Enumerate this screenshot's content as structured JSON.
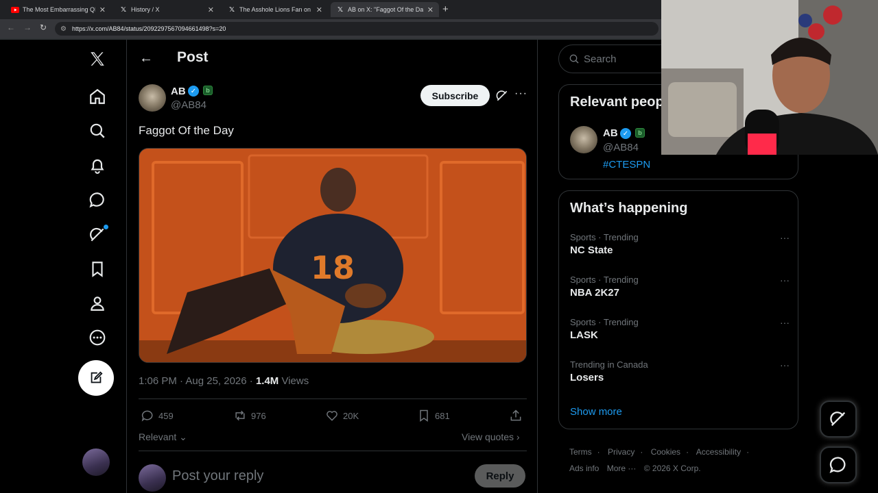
{
  "browser": {
    "tabs": [
      {
        "label": "The Most Embarrassing QB Situ",
        "favicon": "youtube-icon"
      },
      {
        "label": "History / X",
        "favicon": "x-icon"
      },
      {
        "label": "The Asshole Lions Fan on X: \"h",
        "favicon": "x-icon"
      },
      {
        "label": "AB on X: \"Faggot Of the Day ht",
        "favicon": "x-icon"
      }
    ],
    "url": "https://x.com/AB84/status/2092297567094661498?s=20"
  },
  "header": {
    "title": "Post"
  },
  "post": {
    "author_name": "AB",
    "author_handle": "@AB84",
    "subscribe_label": "Subscribe",
    "text": "Faggot Of the Day",
    "time": "1:06 PM · Aug 25, 2026 · ",
    "views_count": "1.4M",
    "views_label": " Views",
    "replies": "459",
    "reposts": "976",
    "likes": "20K",
    "bookmarks": "681",
    "relevant_label": "Relevant",
    "view_quotes_label": "View quotes"
  },
  "reply": {
    "placeholder": "Post your reply",
    "button": "Reply"
  },
  "sidebar": {
    "search_placeholder": "Search",
    "relevant_title": "Relevant people",
    "relevant_person": {
      "name": "AB",
      "handle": "@AB84",
      "bio": "#CTESPN"
    },
    "happening_title": "What’s happening",
    "trends": [
      {
        "meta": "Sports · Trending",
        "name": "NC State"
      },
      {
        "meta": "Sports · Trending",
        "name": "NBA 2K27"
      },
      {
        "meta": "Sports · Trending",
        "name": "LASK"
      },
      {
        "meta": "Trending in Canada",
        "name": "Losers"
      }
    ],
    "show_more": "Show more",
    "footer": [
      "Terms",
      "Privacy",
      "Cookies",
      "Accessibility",
      "Ads info",
      "More ···",
      "© 2026 X Corp."
    ]
  },
  "colors": {
    "accent": "#1d9bf0",
    "background": "#000000",
    "border": "#2f3336"
  }
}
